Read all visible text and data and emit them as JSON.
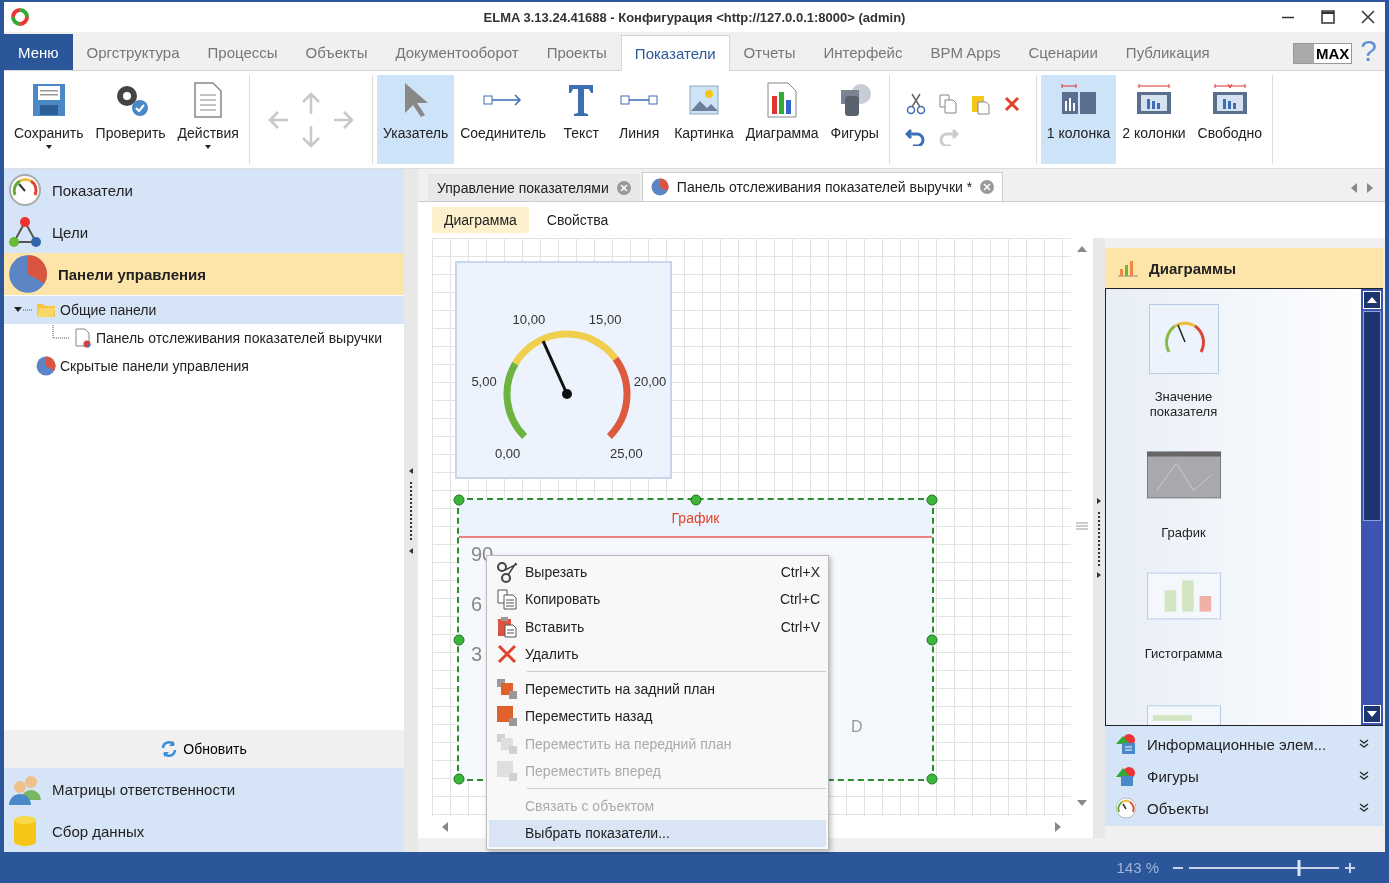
{
  "window": {
    "title": "ELMA 3.13.24.41688 - Конфигурация <http://127.0.0.1:8000> (admin)"
  },
  "ribbon_tabs": [
    {
      "label": "Меню",
      "kind": "menu",
      "selected": false
    },
    {
      "label": "Оргструктура",
      "kind": "tab",
      "selected": false
    },
    {
      "label": "Процессы",
      "kind": "tab",
      "selected": false
    },
    {
      "label": "Объекты",
      "kind": "tab",
      "selected": false
    },
    {
      "label": "Документооборот",
      "kind": "tab",
      "selected": false
    },
    {
      "label": "Проекты",
      "kind": "tab",
      "selected": false
    },
    {
      "label": "Показатели",
      "kind": "tab",
      "selected": true
    },
    {
      "label": "Отчеты",
      "kind": "tab",
      "selected": false
    },
    {
      "label": "Интерфейс",
      "kind": "tab",
      "selected": false
    },
    {
      "label": "BPM Apps",
      "kind": "tab",
      "selected": false
    },
    {
      "label": "Сценарии",
      "kind": "tab",
      "selected": false
    },
    {
      "label": "Публикация",
      "kind": "tab",
      "selected": false
    }
  ],
  "max_badge": "MAX",
  "help": "?",
  "ribbon_groups": [
    {
      "kind": "buttons",
      "buttons": [
        {
          "label": "Сохранить",
          "dropdown": true,
          "selected": false
        },
        {
          "label": "Проверить",
          "dropdown": false,
          "selected": false
        },
        {
          "label": "Действия",
          "dropdown": true,
          "selected": false
        }
      ]
    },
    {
      "kind": "arrows"
    },
    {
      "kind": "buttons",
      "buttons": [
        {
          "label": "Указатель",
          "dropdown": false,
          "selected": true
        },
        {
          "label": "Соединитель",
          "dropdown": false,
          "selected": false
        },
        {
          "label": "Текст",
          "dropdown": false,
          "selected": false
        },
        {
          "label": "Линия",
          "dropdown": false,
          "selected": false
        },
        {
          "label": "Картинка",
          "dropdown": false,
          "selected": false
        },
        {
          "label": "Диаграмма",
          "dropdown": false,
          "selected": false
        },
        {
          "label": "Фигуры",
          "dropdown": false,
          "selected": false
        }
      ]
    },
    {
      "kind": "edit"
    },
    {
      "kind": "buttons",
      "buttons": [
        {
          "label": "1 колонка",
          "dropdown": false,
          "selected": true
        },
        {
          "label": "2 колонки",
          "dropdown": false,
          "selected": false
        },
        {
          "label": "Свободно",
          "dropdown": false,
          "selected": false
        }
      ]
    }
  ],
  "left_nav": {
    "top_items": [
      {
        "label": "Показатели",
        "selected": false
      },
      {
        "label": "Цели",
        "selected": false
      },
      {
        "label": "Панели управления",
        "selected": true
      }
    ],
    "tree": [
      {
        "label": "Общие панели",
        "expanded": true,
        "selected": true,
        "children": [
          {
            "label": "Панель отслеживания показателей выручки",
            "selected": false
          }
        ]
      },
      {
        "label": "Скрытые панели управления",
        "selected": false
      }
    ],
    "refresh": "Обновить",
    "bottom_items": [
      {
        "label": "Матрицы ответственности",
        "selected": false
      },
      {
        "label": "Сбор данных",
        "selected": false
      }
    ]
  },
  "doc_tabs": [
    {
      "label": "Управление показателями",
      "selected": false
    },
    {
      "label": "Панель отслеживания показателей выручки *",
      "selected": true
    }
  ],
  "sub_tabs": [
    {
      "label": "Диаграмма",
      "selected": true
    },
    {
      "label": "Свойства",
      "selected": false
    }
  ],
  "canvas": {
    "gauge": {
      "labels": [
        "0,00",
        "5,00",
        "10,00",
        "15,00",
        "20,00",
        "25,00"
      ],
      "level": 0.41
    },
    "chart": {
      "title": "График",
      "selected": true,
      "y_labels": [
        "90",
        "6",
        "3"
      ],
      "x_label": "D"
    }
  },
  "context_menu": [
    {
      "kind": "item",
      "label": "Вырезать",
      "shortcut": "Ctrl+X",
      "disabled": false,
      "selected": false
    },
    {
      "kind": "item",
      "label": "Копировать",
      "shortcut": "Ctrl+C",
      "disabled": false,
      "selected": false
    },
    {
      "kind": "item",
      "label": "Вставить",
      "shortcut": "Ctrl+V",
      "disabled": false,
      "selected": false
    },
    {
      "kind": "item",
      "label": "Удалить",
      "disabled": false,
      "selected": false
    },
    {
      "kind": "separator"
    },
    {
      "kind": "item",
      "label": "Переместить на задний план",
      "disabled": false,
      "selected": false
    },
    {
      "kind": "item",
      "label": "Переместить назад",
      "disabled": false,
      "selected": false
    },
    {
      "kind": "item",
      "label": "Переместить на передний план",
      "disabled": true,
      "selected": false
    },
    {
      "kind": "item",
      "label": "Переместить вперед",
      "disabled": true,
      "selected": false
    },
    {
      "kind": "separator"
    },
    {
      "kind": "item",
      "label": "Связать с объектом",
      "disabled": true,
      "selected": false
    },
    {
      "kind": "item",
      "label": "Выбрать показатели...",
      "disabled": false,
      "selected": true
    }
  ],
  "palette": {
    "title": "Диаграммы",
    "items": [
      {
        "label": "Значение показателя",
        "kind": "gauge"
      },
      {
        "label": "График",
        "kind": "line"
      },
      {
        "label": "Гистограмма",
        "kind": "bar"
      },
      {
        "kind": "table"
      }
    ],
    "sections": [
      {
        "label": "Информационные элем..."
      },
      {
        "label": "Фигуры"
      },
      {
        "label": "Объекты"
      }
    ]
  },
  "status_bar": {
    "zoom": "143 %",
    "level": 0.73
  }
}
